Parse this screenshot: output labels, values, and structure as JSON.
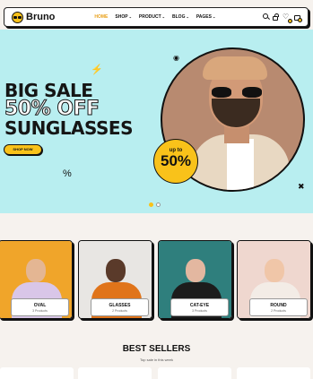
{
  "brand": {
    "name": "Bruno"
  },
  "nav": [
    {
      "label": "HOME",
      "active": true,
      "dropdown": false
    },
    {
      "label": "SHOP",
      "active": false,
      "dropdown": true
    },
    {
      "label": "PRODUCT",
      "active": false,
      "dropdown": true
    },
    {
      "label": "BLOG",
      "active": false,
      "dropdown": true
    },
    {
      "label": "PAGES",
      "active": false,
      "dropdown": true
    }
  ],
  "header_icons": [
    "search-icon",
    "lock-icon",
    "heart-icon",
    "cart-icon"
  ],
  "hero": {
    "line1": "BIG SALE",
    "line2": "50% OFF",
    "line3": "SUNGLASSES",
    "button": "SHOP NOW",
    "promo_top": "up to",
    "promo_value": "50%",
    "slide_count": 2,
    "active_slide": 1
  },
  "categories": [
    {
      "name": "OVAL",
      "count": "3 Products"
    },
    {
      "name": "GLASSES",
      "count": "2 Products"
    },
    {
      "name": "CAT-EYE",
      "count": "3 Products"
    },
    {
      "name": "ROUND",
      "count": "2 Products"
    }
  ],
  "best_sellers": {
    "title": "BEST SELLERS",
    "subtitle": "Top sale in this week"
  },
  "colors": {
    "accent": "#f9c21a",
    "hero_bg": "#b8eef0",
    "page_bg": "#f6f2ee",
    "ink": "#111111"
  }
}
